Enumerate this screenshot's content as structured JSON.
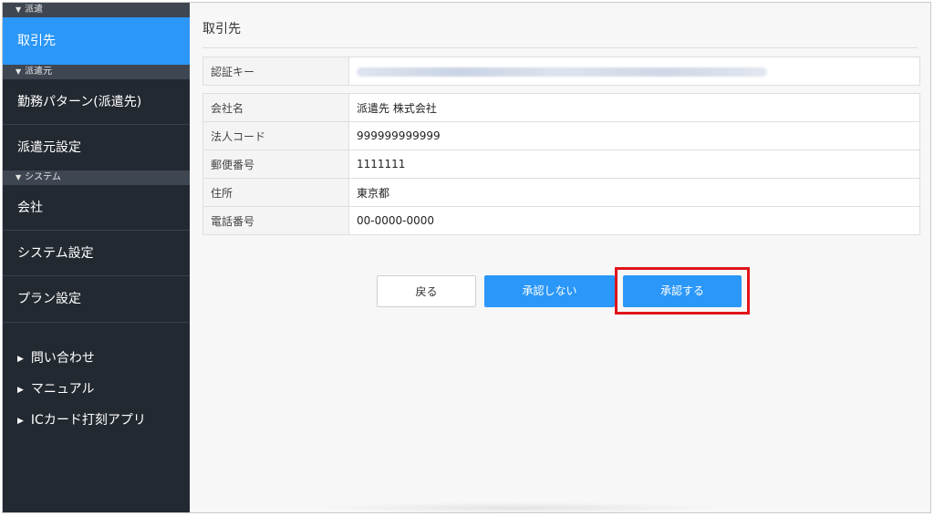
{
  "sidebar": {
    "sections": [
      {
        "header": "派遣",
        "items": [
          {
            "label": "取引先",
            "active": true
          }
        ]
      },
      {
        "header": "派遣元",
        "items": [
          {
            "label": "勤務パターン(派遣先)"
          },
          {
            "label": "派遣元設定"
          }
        ]
      },
      {
        "header": "システム",
        "items": [
          {
            "label": "会社"
          },
          {
            "label": "システム設定"
          },
          {
            "label": "プラン設定"
          }
        ]
      }
    ],
    "links": [
      "問い合わせ",
      "マニュアル",
      "ICカード打刻アプリ"
    ]
  },
  "main": {
    "title": "取引先",
    "auth_key": {
      "label": "認証キー"
    },
    "fields": [
      {
        "key": "会社名",
        "value": "派遣先 株式会社"
      },
      {
        "key": "法人コード",
        "value": "999999999999"
      },
      {
        "key": "郵便番号",
        "value": "1111111"
      },
      {
        "key": "住所",
        "value": "東京都"
      },
      {
        "key": "電話番号",
        "value": "00-0000-0000"
      }
    ],
    "buttons": {
      "back": "戻る",
      "reject": "承認しない",
      "approve": "承認する"
    }
  },
  "colors": {
    "accent": "#2b97f8",
    "sidebar_bg": "#232931",
    "highlight": "#e1141b"
  }
}
